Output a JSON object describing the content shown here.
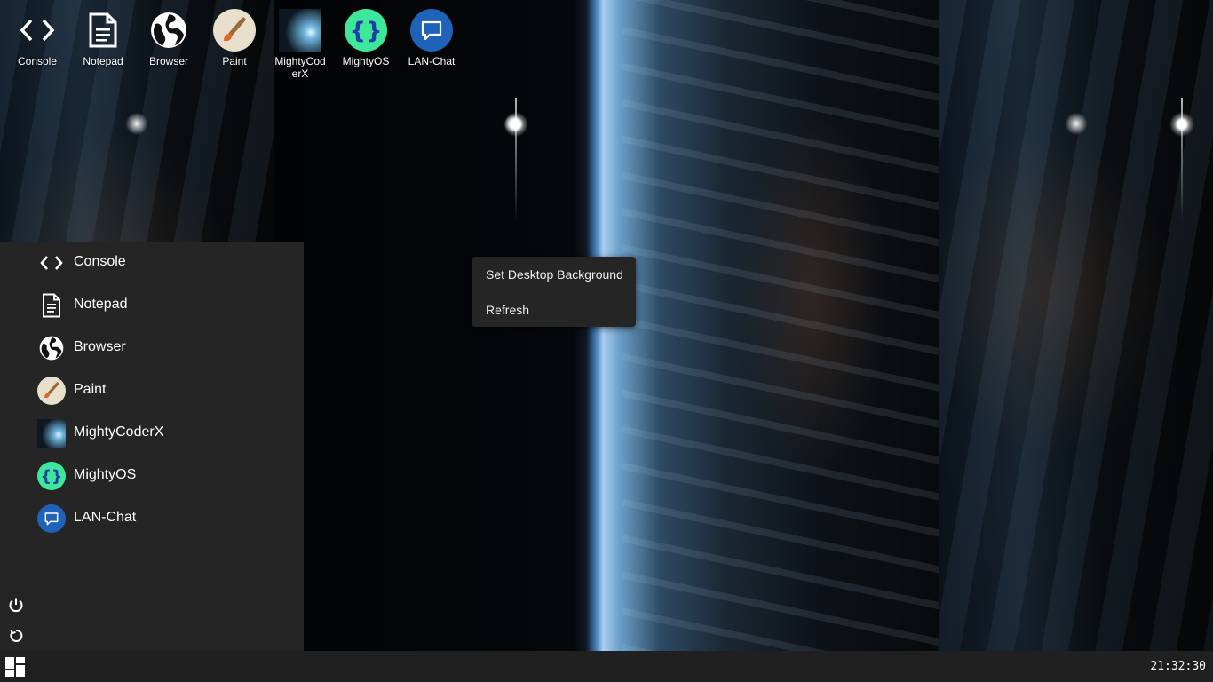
{
  "desktop_icons": [
    {
      "label": "Console",
      "icon": "code-brackets-icon"
    },
    {
      "label": "Notepad",
      "icon": "document-icon"
    },
    {
      "label": "Browser",
      "icon": "globe-icon"
    },
    {
      "label": "Paint",
      "icon": "paintbrush-icon"
    },
    {
      "label": "MightyCoderX",
      "icon": "mightycoderx-icon"
    },
    {
      "label": "MightyOS",
      "icon": "curly-braces-icon"
    },
    {
      "label": "LAN-Chat",
      "icon": "chat-bubble-icon"
    }
  ],
  "start_menu": {
    "items": [
      {
        "label": "Console",
        "icon": "code-brackets-icon"
      },
      {
        "label": "Notepad",
        "icon": "document-icon"
      },
      {
        "label": "Browser",
        "icon": "globe-icon"
      },
      {
        "label": "Paint",
        "icon": "paintbrush-icon"
      },
      {
        "label": "MightyCoderX",
        "icon": "mightycoderx-icon"
      },
      {
        "label": "MightyOS",
        "icon": "curly-braces-icon"
      },
      {
        "label": "LAN-Chat",
        "icon": "chat-bubble-icon"
      }
    ],
    "power_icon": "power-icon",
    "restart_icon": "restart-icon"
  },
  "context_menu": {
    "items": [
      {
        "label": "Set Desktop Background"
      },
      {
        "label": "Refresh"
      }
    ]
  },
  "taskbar": {
    "start_icon": "windows-grid-icon",
    "clock": "21:32:30"
  },
  "colors": {
    "menu_bg": "#252525",
    "taskbar_bg": "#202020",
    "mightyos_green": "#3ee89a",
    "lanchat_blue": "#1e63b8",
    "paint_beige": "#e8e0cc"
  }
}
